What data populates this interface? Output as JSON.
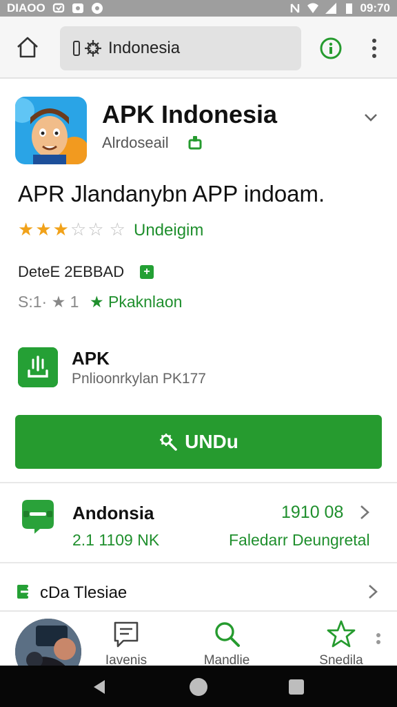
{
  "status_bar": {
    "carrier": "DIAOO",
    "time": "09:70"
  },
  "browser": {
    "url_text": "Indonesia",
    "icons": [
      "home-icon",
      "lock-icon",
      "settings-icon",
      "info-icon",
      "more-vert-icon"
    ]
  },
  "app": {
    "title": "APK Indonesia",
    "developer": "Alrdoseail",
    "subtitle": "APR Jlandanybn APP indoam.",
    "rating_stars": 3,
    "rating_max": 5,
    "rating_label": "Undeigim",
    "detail_label": "DeteE 2EBBAD",
    "detail_badge": "+",
    "stats_left": "S:1· ★ 1",
    "stats_right": "★ Pkaknlaon"
  },
  "apk": {
    "title": "APK",
    "subtitle": "Pnlioonrkylan PK177"
  },
  "download_button": {
    "label": "UNDu"
  },
  "list": {
    "row1": {
      "title": "Andonsia",
      "size": "2.1 1109 NK",
      "number": "1910 08",
      "description": "Faledarr Deungretal"
    },
    "row2": {
      "label": "cDa Tlesiae"
    }
  },
  "tab_bar": {
    "tabs": [
      {
        "label": "Iavenis",
        "icon": "message-icon"
      },
      {
        "label": "Mandlie",
        "icon": "search-icon"
      },
      {
        "label": "Snedila",
        "icon": "star-icon"
      }
    ]
  },
  "colors": {
    "accent_green": "#269b2f",
    "star_gold": "#f1a21a",
    "status_bar_bg": "#9e9e9e"
  }
}
